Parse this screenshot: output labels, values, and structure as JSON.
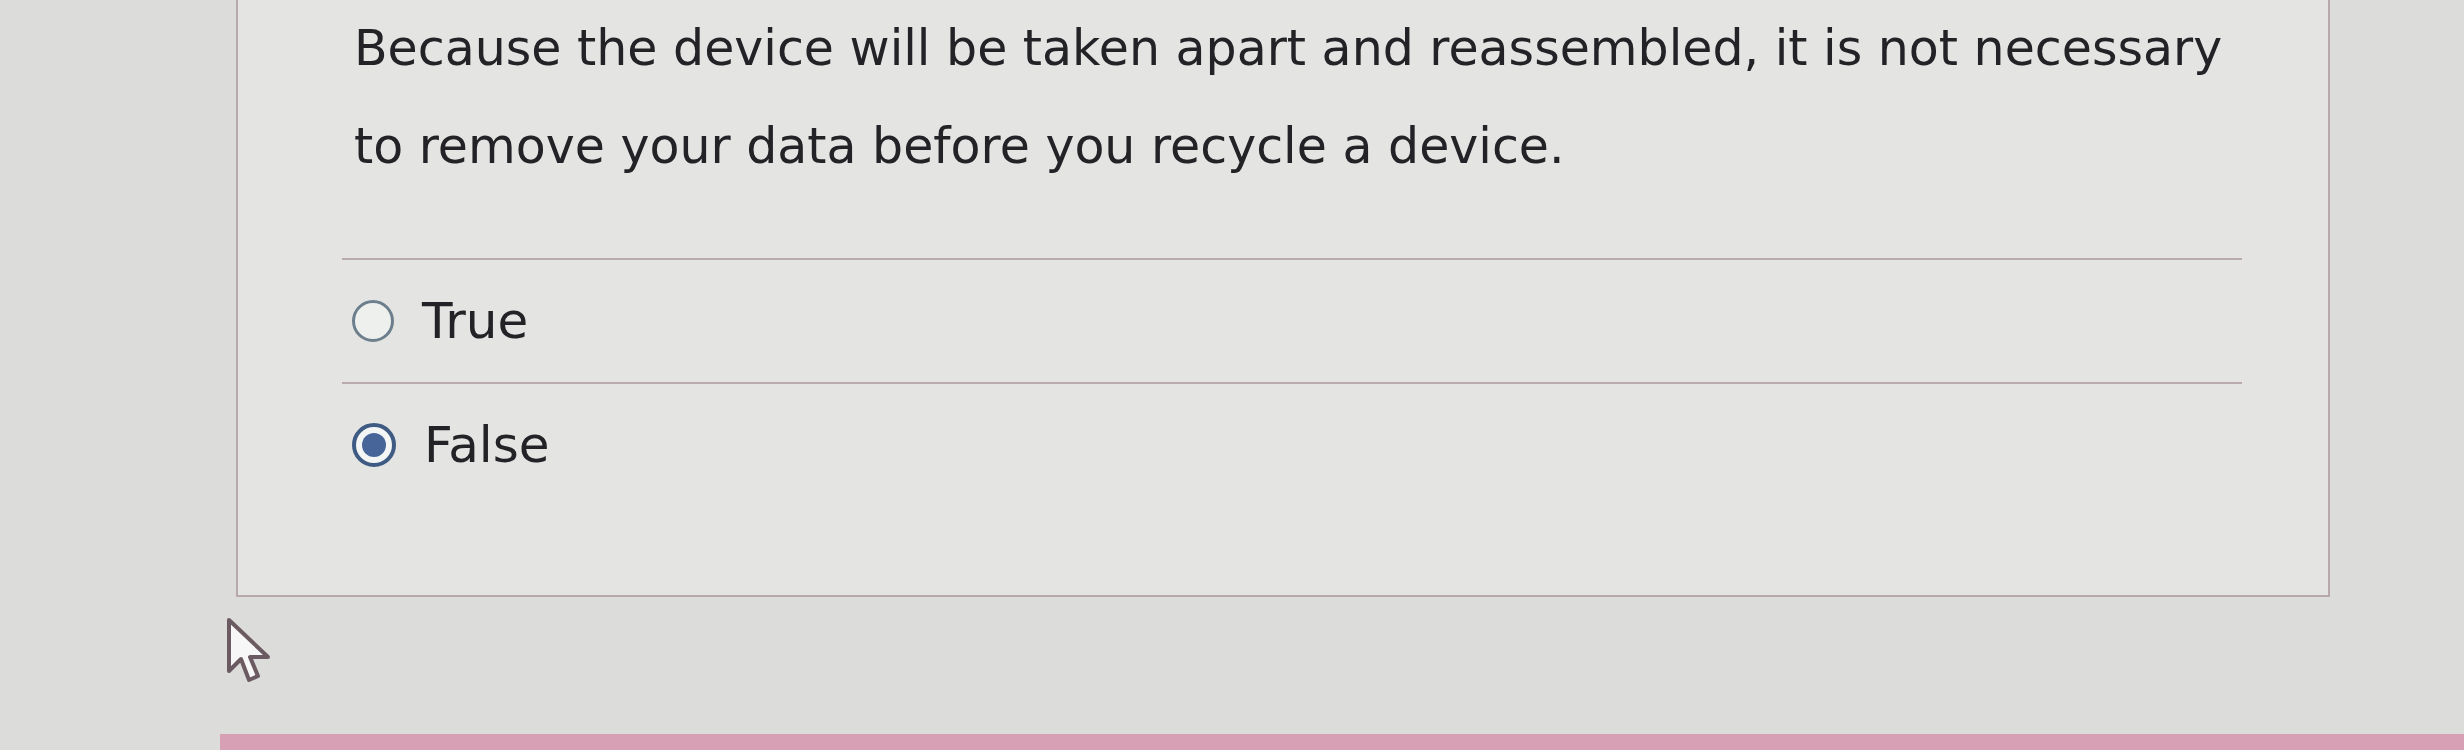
{
  "question": {
    "text": "Because the device will be taken apart and reassembled, it is not necessary to remove your data before you recycle a device."
  },
  "options": [
    {
      "label": "True",
      "selected": false
    },
    {
      "label": "False",
      "selected": true
    }
  ]
}
